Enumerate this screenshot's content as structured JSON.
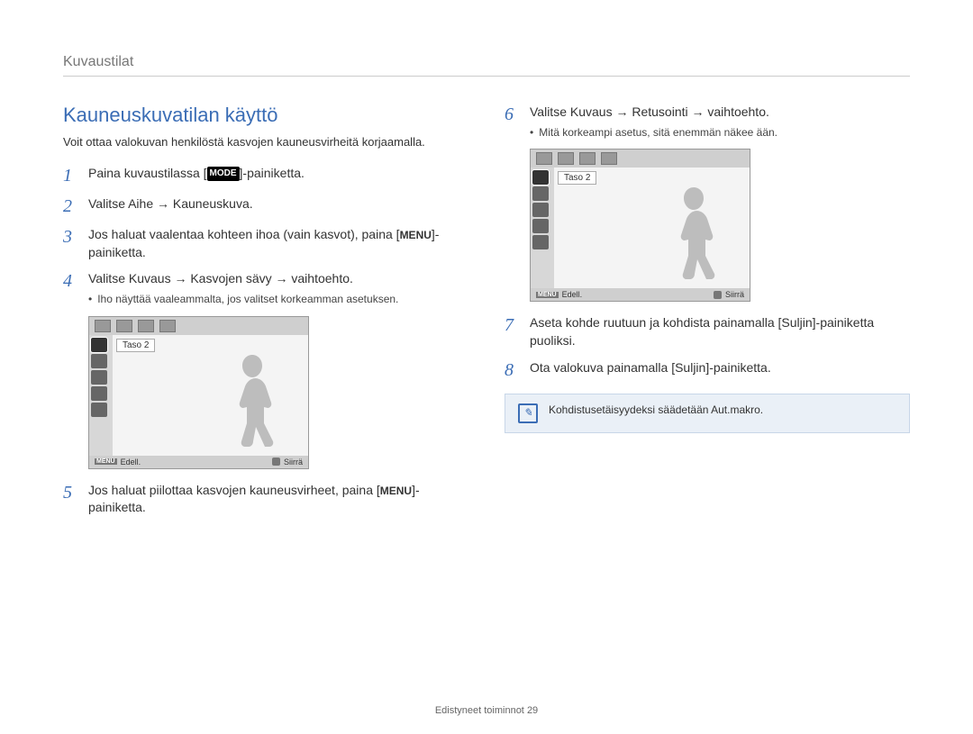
{
  "breadcrumb": "Kuvaustilat",
  "section_title": "Kauneuskuvatilan käyttö",
  "intro": "Voit ottaa valokuvan henkilöstä kasvojen kauneusvirheitä korjaamalla.",
  "mode_badge": "MODE",
  "menu_badge": "MENU",
  "left_steps": {
    "1": "Paina kuvaustilassa [",
    "1b": "]-painiketta.",
    "2": "Valitse Aihe → Kauneuskuva.",
    "3a": "Jos haluat vaalentaa kohteen ihoa (vain kasvot), paina [",
    "3b": "]-painiketta.",
    "4": "Valitse Kuvaus → Kasvojen sävy → vaihtoehto.",
    "4_note": "Iho näyttää vaaleammalta, jos valitset korkeamman asetuksen.",
    "5a": "Jos haluat piilottaa kasvojen kauneusvirheet, paina [",
    "5b": "]-painiketta."
  },
  "right_steps": {
    "6": "Valitse Kuvaus → Retusointi → vaihtoehto.",
    "6_note": "Mitä korkeampi asetus, sitä enemmän näkee ään.",
    "7": "Aseta kohde ruutuun ja kohdista painamalla [Suljin]-painiketta puoliksi.",
    "8": "Ota valokuva painamalla [Suljin]-painiketta."
  },
  "lcd": {
    "label": "Taso 2",
    "back": "Edell.",
    "move": "Siirrä"
  },
  "tip": "Kohdistusetäisyydeksi säädetään Aut.makro.",
  "footer_label": "Edistyneet toiminnot",
  "footer_page": "29"
}
